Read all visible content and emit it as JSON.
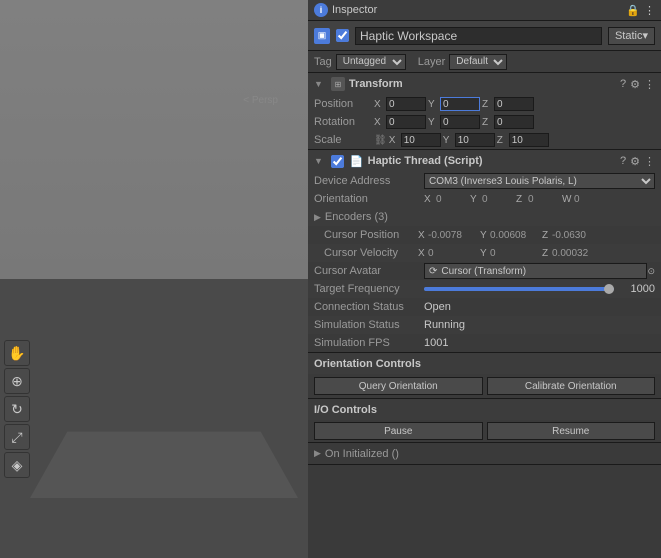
{
  "scene": {
    "persp_label": "< Persp"
  },
  "inspector": {
    "title": "Inspector",
    "header_icons": [
      "─",
      "⋮",
      "⋮"
    ],
    "gameobject": {
      "name": "Haptic Workspace",
      "static_label": "Static",
      "tag_label": "Tag",
      "tag_value": "Untagged",
      "layer_label": "Layer",
      "layer_value": "Default"
    },
    "transform": {
      "title": "Transform",
      "position_label": "Position",
      "position_x": "0",
      "position_y": "0",
      "position_z": "0",
      "rotation_label": "Rotation",
      "rotation_x": "0",
      "rotation_y": "0",
      "rotation_z": "0",
      "scale_label": "Scale",
      "scale_x": "10",
      "scale_y": "10",
      "scale_z": "10"
    },
    "haptic_thread": {
      "title": "Haptic Thread (Script)",
      "device_address_label": "Device Address",
      "device_address_value": "COM3 (Inverse3 Louis Polaris, L)",
      "orientation_label": "Orientation",
      "orientation_x": "0",
      "orientation_y": "0",
      "orientation_z": "0",
      "orientation_w": "0",
      "encoders_label": "Encoders (3)",
      "cursor_position_label": "Cursor Position",
      "cursor_position_x": "-0.0078",
      "cursor_position_y": "0.00608",
      "cursor_position_z": "-0.0630",
      "cursor_velocity_label": "Cursor Velocity",
      "cursor_velocity_x": "0",
      "cursor_velocity_y": "0",
      "cursor_velocity_z": "0.00032",
      "cursor_avatar_label": "Cursor Avatar",
      "cursor_avatar_value": "Cursor (Transform)",
      "target_frequency_label": "Target Frequency",
      "target_frequency_value": "1000",
      "connection_status_label": "Connection Status",
      "connection_status_value": "Open",
      "simulation_status_label": "Simulation Status",
      "simulation_status_value": "Running",
      "simulation_fps_label": "Simulation FPS",
      "simulation_fps_value": "1001",
      "orientation_controls_title": "Orientation Controls",
      "query_orientation_label": "Query Orientation",
      "calibrate_orientation_label": "Calibrate Orientation",
      "io_controls_title": "I/O Controls",
      "pause_label": "Pause",
      "resume_label": "Resume",
      "on_initialized_label": "On Initialized ()"
    },
    "toolbar": {
      "left_tools": [
        "✋",
        "⊕",
        "↻",
        "⤢",
        "◈"
      ]
    }
  }
}
